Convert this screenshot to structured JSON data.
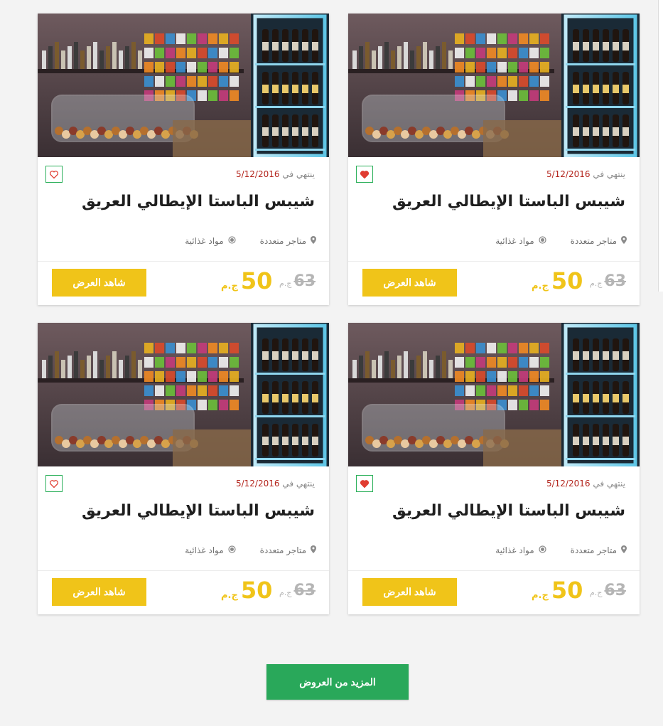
{
  "offers": [
    {
      "title": "شيبس الباستا الإيطالي العريق",
      "expiry_label": "ينتهي في",
      "expiry_date": "5/12/2016",
      "location": "متاجر متعددة",
      "category": "مواد غذائية",
      "old_price": "63",
      "new_price": "50",
      "currency": "ج.م",
      "cta_label": "شاهد العرض",
      "favorited": true
    },
    {
      "title": "شيبس الباستا الإيطالي العريق",
      "expiry_label": "ينتهي في",
      "expiry_date": "5/12/2016",
      "location": "متاجر متعددة",
      "category": "مواد غذائية",
      "old_price": "63",
      "new_price": "50",
      "currency": "ج.م",
      "cta_label": "شاهد العرض",
      "favorited": false
    },
    {
      "title": "شيبس الباستا الإيطالي العريق",
      "expiry_label": "ينتهي في",
      "expiry_date": "5/12/2016",
      "location": "متاجر متعددة",
      "category": "مواد غذائية",
      "old_price": "63",
      "new_price": "50",
      "currency": "ج.م",
      "cta_label": "شاهد العرض",
      "favorited": true
    },
    {
      "title": "شيبس الباستا الإيطالي العريق",
      "expiry_label": "ينتهي في",
      "expiry_date": "5/12/2016",
      "location": "متاجر متعددة",
      "category": "مواد غذائية",
      "old_price": "63",
      "new_price": "50",
      "currency": "ج.م",
      "cta_label": "شاهد العرض",
      "favorited": false
    }
  ],
  "load_more_label": "المزيد من العروض",
  "icons": {
    "favorite": "heart-icon",
    "location": "map-pin-icon",
    "category": "category-dot-icon"
  },
  "colors": {
    "accent_yellow": "#f0c419",
    "accent_green": "#29a85a",
    "heart_border": "#2bb05a",
    "heart_fill": "#e03c31",
    "expiry_date": "#b3241c"
  }
}
